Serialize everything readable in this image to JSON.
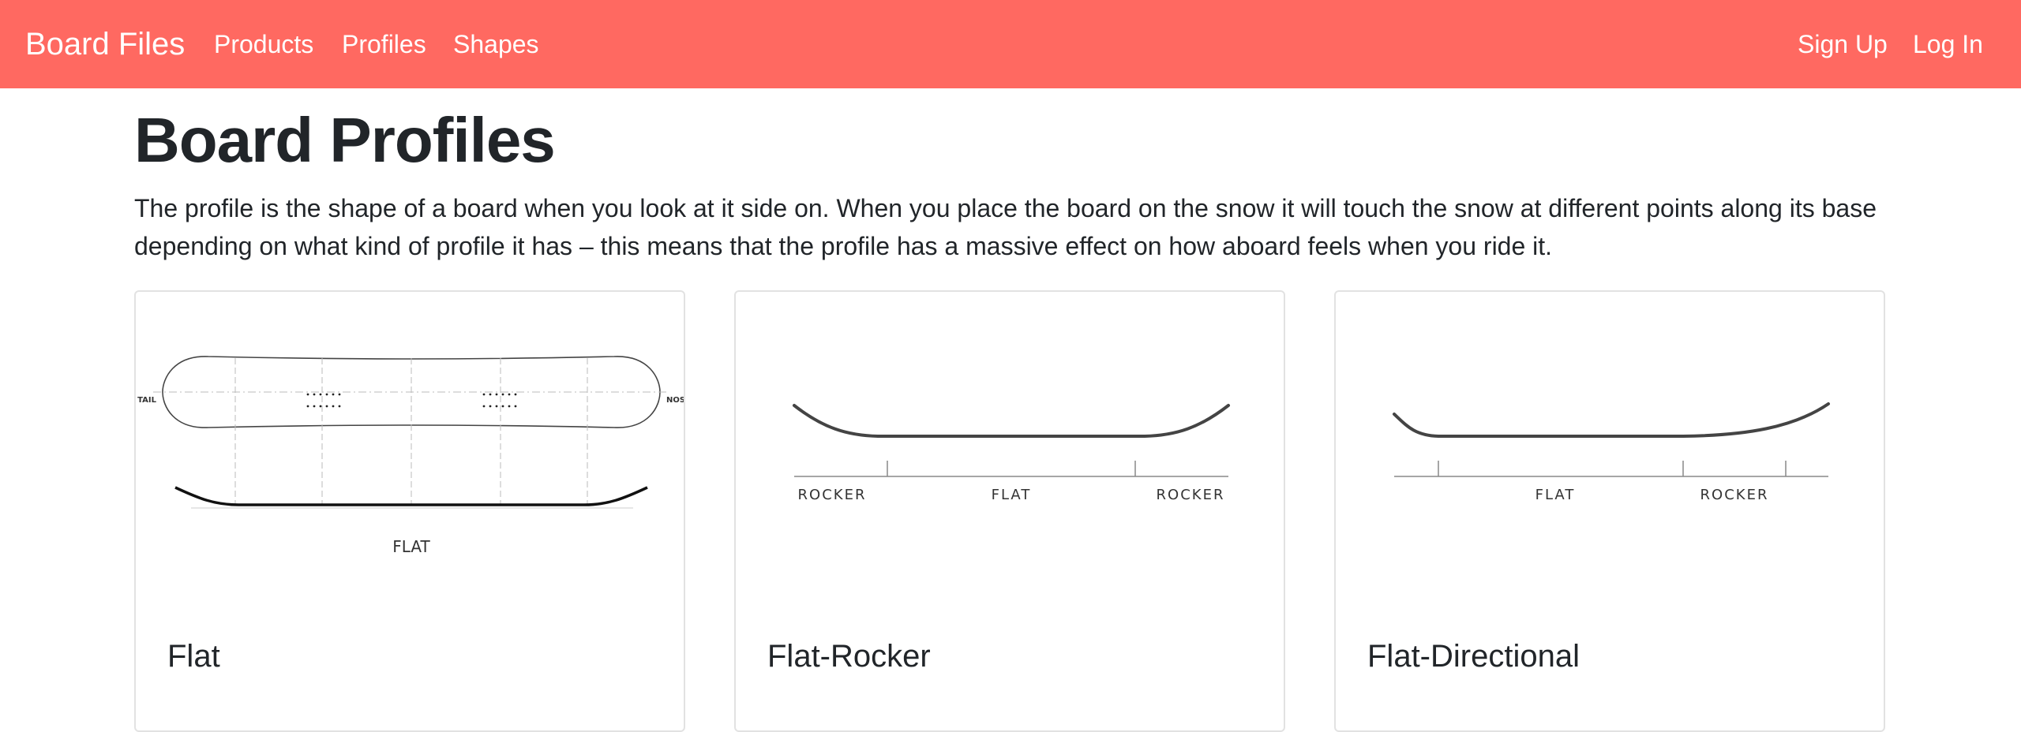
{
  "navbar": {
    "brand": "Board Files",
    "links": [
      "Products",
      "Profiles",
      "Shapes"
    ],
    "auth": [
      "Sign Up",
      "Log In"
    ]
  },
  "page": {
    "title": "Board Profiles",
    "intro": "The profile is the shape of a board when you look at it side on. When you place the board on the snow it will touch the snow at different points along its base depending on what kind of profile it has – this means that the profile has a massive effect on how aboard feels when you ride it."
  },
  "cards": [
    {
      "title": "Flat",
      "diagram": {
        "tail": "TAIL",
        "nose": "NOSE",
        "labels": [
          "FLAT"
        ]
      }
    },
    {
      "title": "Flat-Rocker",
      "diagram": {
        "labels": [
          "ROCKER",
          "FLAT",
          "ROCKER"
        ]
      }
    },
    {
      "title": "Flat-Directional",
      "diagram": {
        "labels": [
          "FLAT",
          "ROCKER"
        ]
      }
    }
  ]
}
